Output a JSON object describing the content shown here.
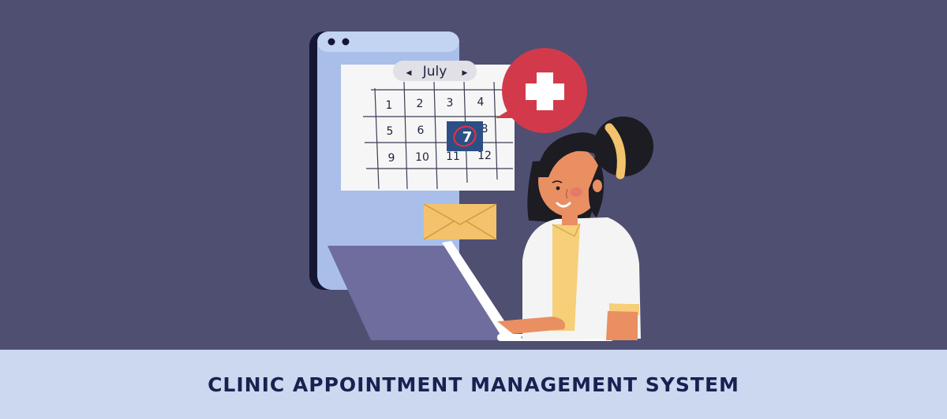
{
  "calendar": {
    "month": "July",
    "prev_arrow": "◀",
    "next_arrow": "▶",
    "days": [
      "1",
      "2",
      "3",
      "4",
      "5",
      "6",
      "8",
      "9",
      "10",
      "11",
      "12"
    ],
    "selected_day": "7"
  },
  "banner": {
    "title": "CLINIC APPOINTMENT MANAGEMENT SYSTEM"
  },
  "colors": {
    "background": "#4f4f72",
    "banner": "#cbd8f0",
    "title_text": "#1a2150",
    "medical_badge": "#d23a4b",
    "envelope": "#f2c26c",
    "selected_day": "#2c4f86",
    "skin": "#e98f62",
    "hair": "#1c1c22"
  },
  "icons": [
    "medical-cross-icon",
    "envelope-icon",
    "calendar-icon"
  ]
}
